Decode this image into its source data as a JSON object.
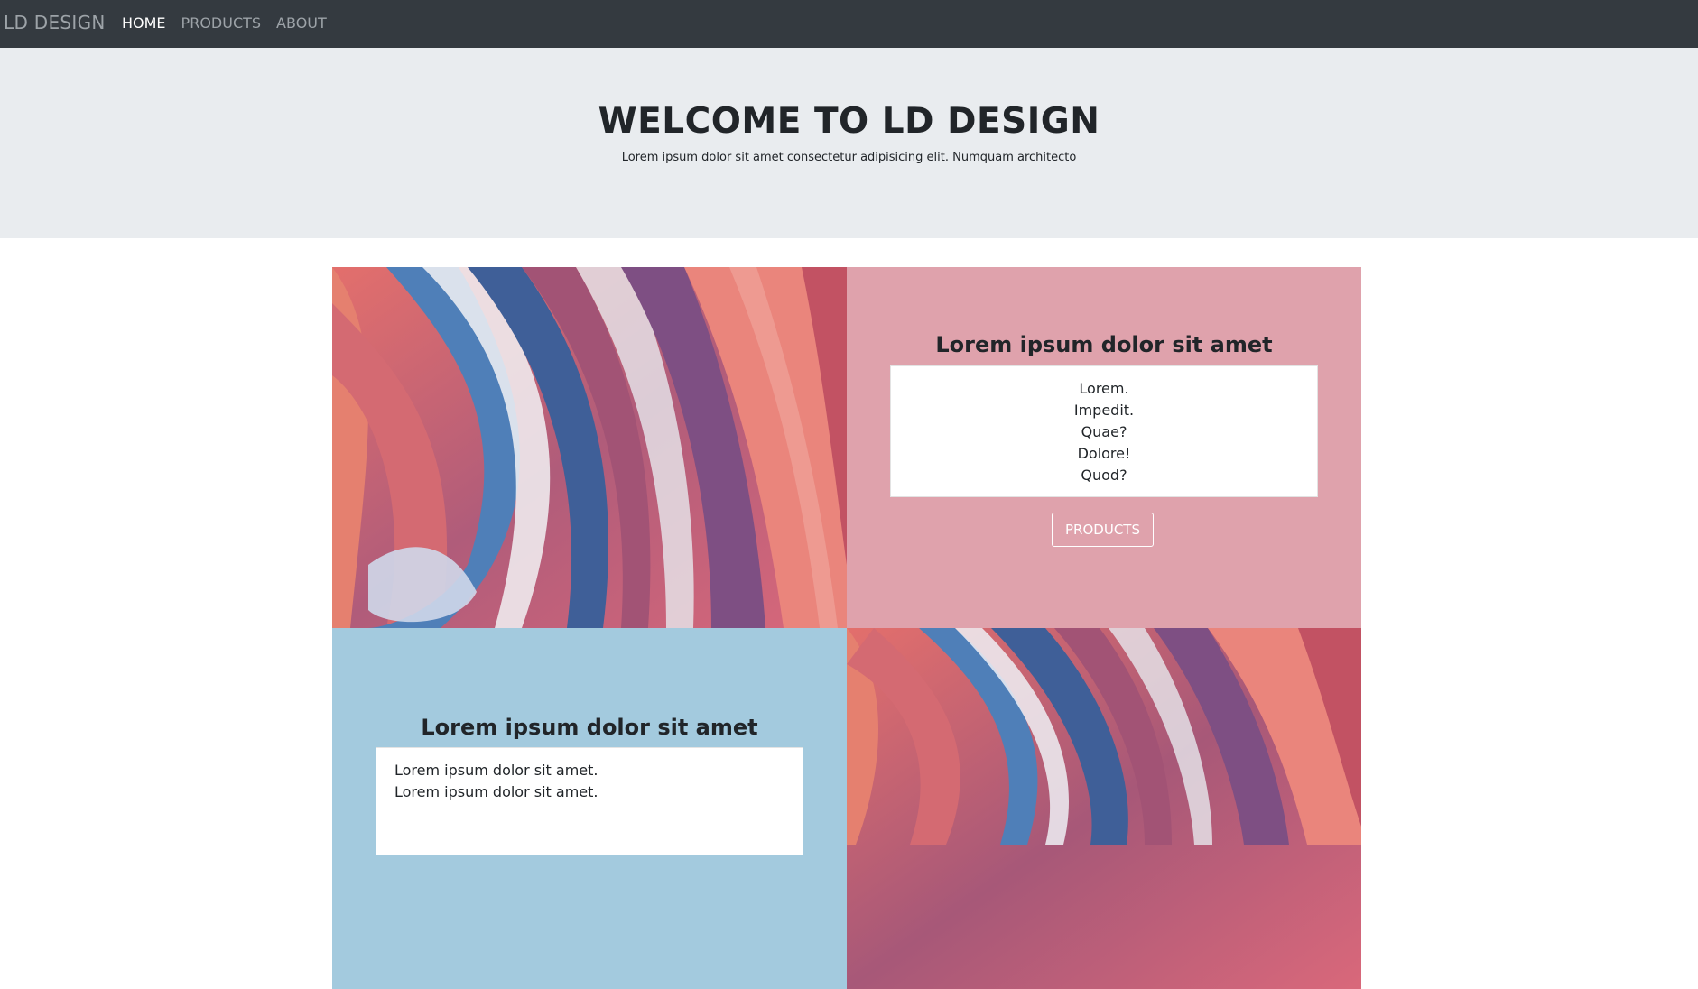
{
  "navbar": {
    "brand": "LD DESIGN",
    "links": [
      {
        "label": "HOME",
        "active": true
      },
      {
        "label": "PRODUCTS",
        "active": false
      },
      {
        "label": "ABOUT",
        "active": false
      }
    ]
  },
  "hero": {
    "title": "WELCOME TO LD DESIGN",
    "lead": "Lorem ipsum dolor sit amet consectetur adipisicing elit. Numquam architecto"
  },
  "section_one": {
    "title": "Lorem ipsum dolor sit amet",
    "items": [
      "Lorem.",
      "Impedit.",
      "Quae?",
      "Dolore!",
      "Quod?"
    ],
    "button_label": "PRODUCTS"
  },
  "section_two": {
    "title": "Lorem ipsum dolor sit amet",
    "items": [
      "Lorem ipsum dolor sit amet.",
      "Lorem ipsum dolor sit amet."
    ]
  },
  "colors": {
    "navbar_bg": "#343a40",
    "hero_bg": "#e9ecef",
    "pink_panel": "#dfa2ac",
    "blue_panel": "#a3cade"
  }
}
